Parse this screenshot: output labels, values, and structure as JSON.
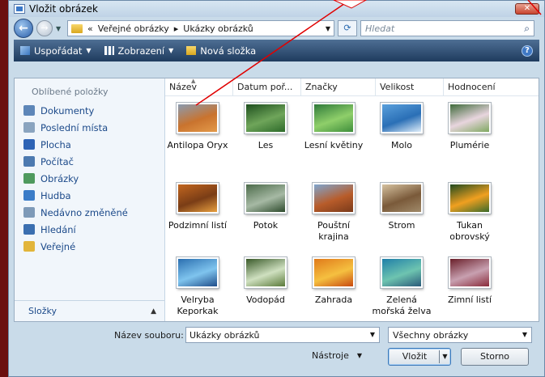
{
  "window": {
    "title": "Vložit obrázek",
    "close_label": "✕"
  },
  "address": {
    "chevron": "«",
    "path": [
      "Veřejné obrázky",
      "Ukázky obrázků"
    ],
    "separator": "▸"
  },
  "search": {
    "placeholder": "Hledat"
  },
  "toolbar": {
    "organize": "Uspořádat",
    "views": "Zobrazení",
    "new_folder": "Nová složka",
    "help": "?"
  },
  "sidebar": {
    "section": "Oblíbené položky",
    "items": [
      {
        "label": "Dokumenty",
        "icon": "documents-icon",
        "color": "#5d86b8"
      },
      {
        "label": "Poslední místa",
        "icon": "recent-places-icon",
        "color": "#8aa4bf"
      },
      {
        "label": "Plocha",
        "icon": "desktop-icon",
        "color": "#2d63b5"
      },
      {
        "label": "Počítač",
        "icon": "computer-icon",
        "color": "#4d7ab0"
      },
      {
        "label": "Obrázky",
        "icon": "pictures-icon",
        "color": "#4f9a5e"
      },
      {
        "label": "Hudba",
        "icon": "music-icon",
        "color": "#3a7cc8"
      },
      {
        "label": "Nedávno změněné",
        "icon": "recently-changed-icon",
        "color": "#7e9ab8"
      },
      {
        "label": "Hledání",
        "icon": "search-folder-icon",
        "color": "#3b6fb0"
      },
      {
        "label": "Veřejné",
        "icon": "public-folder-icon",
        "color": "#e2b53a"
      }
    ],
    "folders_label": "Složky",
    "folders_chevron": "▲"
  },
  "columns": [
    "Název",
    "Datum poř...",
    "Značky",
    "Velikost",
    "Hodnocení"
  ],
  "files": [
    {
      "name": "Antilopa Oryx",
      "colors": [
        "#8a9bb0",
        "#c9732e",
        "#e39a4a"
      ]
    },
    {
      "name": "Les",
      "colors": [
        "#1e4f1e",
        "#6fa55a",
        "#2d6a2a"
      ]
    },
    {
      "name": "Lesní květiny",
      "colors": [
        "#2f7a3a",
        "#8fcf6a",
        "#3e8e3b"
      ]
    },
    {
      "name": "Molo",
      "colors": [
        "#5aa0dc",
        "#2a6fb6",
        "#dfeefa"
      ]
    },
    {
      "name": "Plumérie",
      "colors": [
        "#3e6a3a",
        "#e8d5de",
        "#7fa860"
      ]
    },
    {
      "name": "Podzimní listí",
      "colors": [
        "#c2661f",
        "#7a3d16",
        "#e8a040"
      ]
    },
    {
      "name": "Potok",
      "colors": [
        "#4c6b4a",
        "#a6b9a4",
        "#2d4a2c"
      ]
    },
    {
      "name": "Pouštní krajina",
      "colors": [
        "#7fa6cf",
        "#b85c2a",
        "#7a3a1a"
      ]
    },
    {
      "name": "Strom",
      "colors": [
        "#d6c2a0",
        "#7a5a3a",
        "#a08a6a"
      ]
    },
    {
      "name": "Tukan obrovský",
      "colors": [
        "#1f4a1f",
        "#f0a020",
        "#3a6a2a"
      ]
    },
    {
      "name": "Velryba Keporkak",
      "colors": [
        "#2b6fb0",
        "#7fc4ee",
        "#1f4d8a"
      ]
    },
    {
      "name": "Vodopád",
      "colors": [
        "#3a5a2a",
        "#cfe0c0",
        "#5a7a3a"
      ]
    },
    {
      "name": "Zahrada",
      "colors": [
        "#e07a1a",
        "#f5c040",
        "#c84a10"
      ]
    },
    {
      "name": "Zelená mořská želva",
      "colors": [
        "#1f7fa8",
        "#6ec4b0",
        "#2a5a7a"
      ]
    },
    {
      "name": "Zimní listí",
      "colors": [
        "#6a1f2a",
        "#c8a0b0",
        "#8a2a3a"
      ]
    }
  ],
  "footer": {
    "filename_label": "Název souboru:",
    "filename_value": "Ukázky obrázků",
    "filetype": "Všechny obrázky",
    "tools_label": "Nástroje",
    "insert_label": "Vložit",
    "cancel_label": "Storno"
  },
  "colors": {
    "accent": "#2b6bb0",
    "toolbar": "#1f3b5e",
    "background": "#6b0f0f",
    "annotation_arrow": "#e00000"
  }
}
